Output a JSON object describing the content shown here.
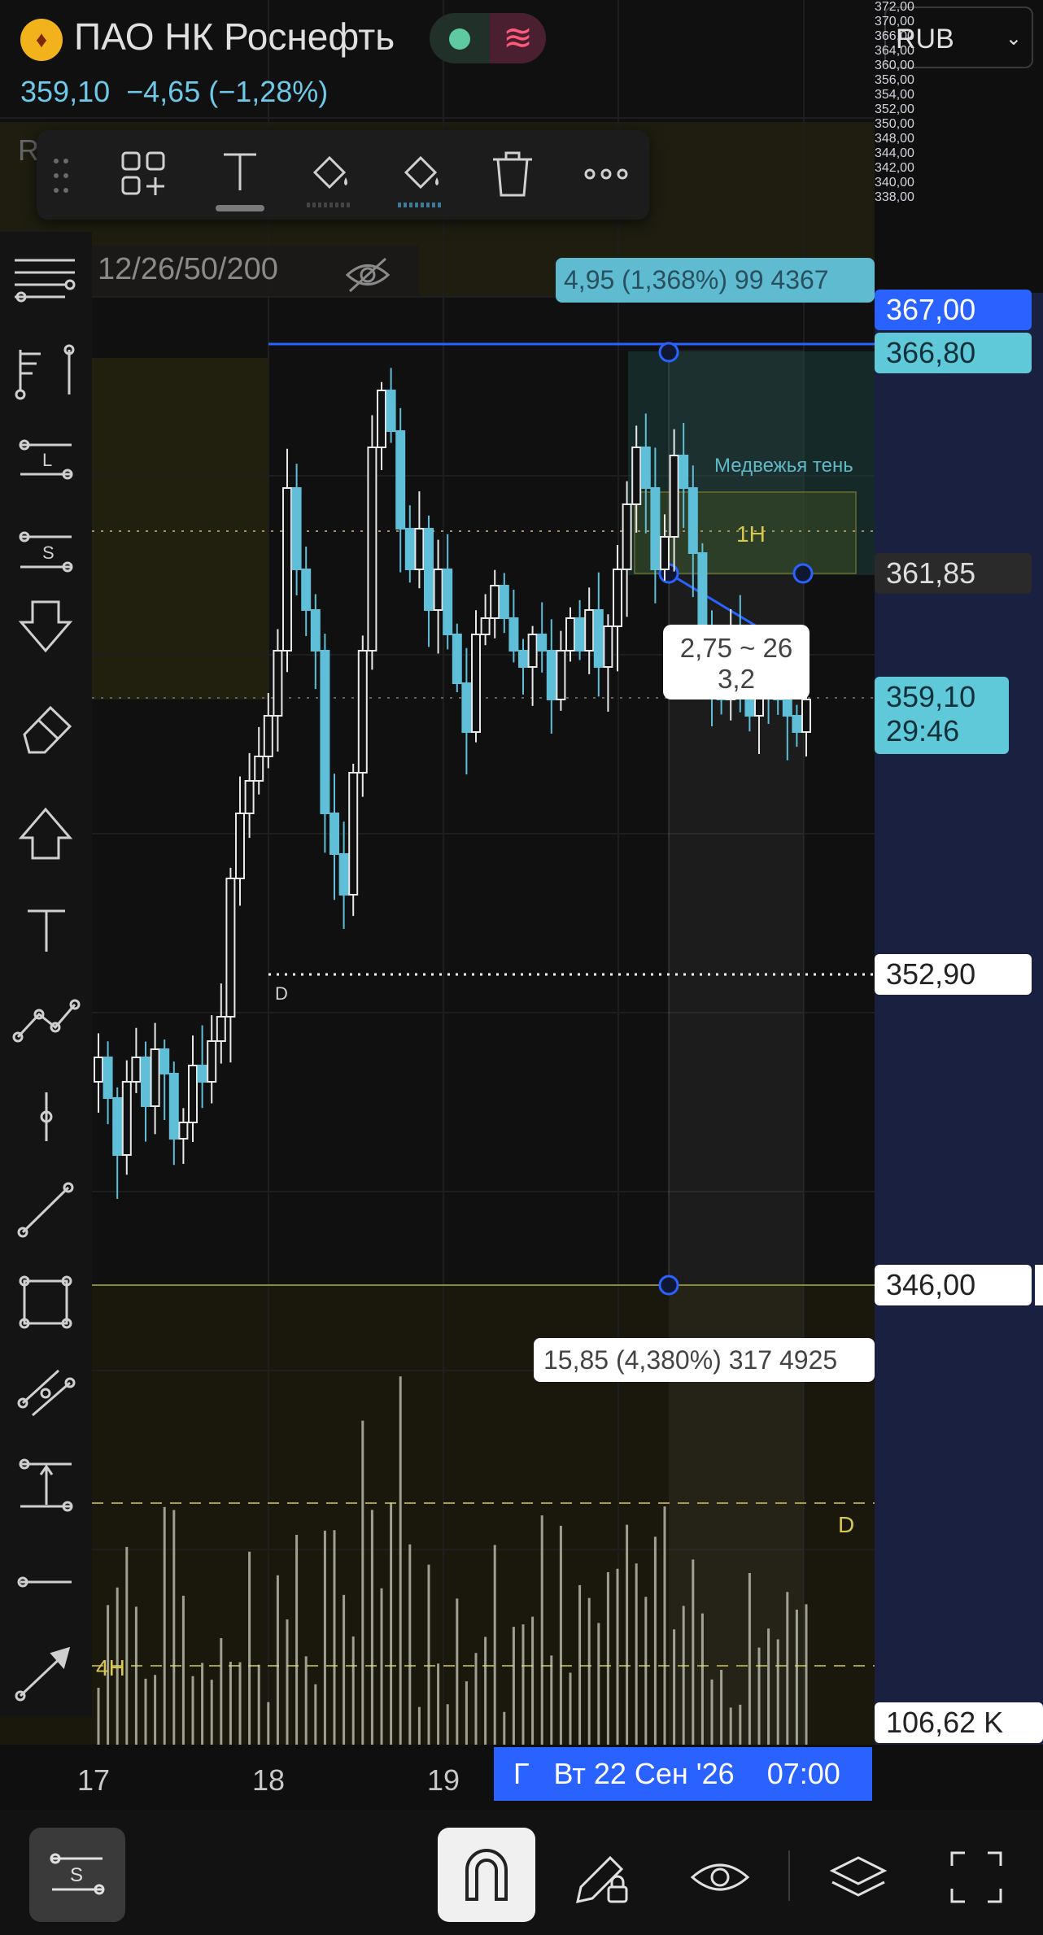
{
  "header": {
    "symbol": "ПАО НК Роснефть",
    "price": "359,10",
    "change": "−4,65 (−1,28%)",
    "currency": "RUB"
  },
  "indicator_label": "12/26/50/200",
  "price_scale": {
    "ticks": [
      "372,00",
      "370,00",
      "366,00",
      "364,00",
      "360,00",
      "356,00",
      "354,00",
      "352,00",
      "350,00",
      "348,00",
      "344,00",
      "342,00",
      "340,00",
      "338,00"
    ],
    "labels": {
      "blue_line": "367,00",
      "cyan_level": "366,80",
      "level_361": "361,85",
      "last_price": "359,10",
      "countdown": "29:46",
      "level_352": "352,90",
      "level_346": "346,00",
      "volume": "106,62 K"
    }
  },
  "annotations": {
    "measure_top": "4,95 (1,368%) 99 4367",
    "measure_bottom": "15,85 (4,380%) 317 4925",
    "bear_shadow": "Медвежья тень",
    "tf_1h": "1H",
    "tf_4h": "4H",
    "marker_d": "D",
    "marker_d2": "D",
    "callout_line1": "2,75 ~ 26",
    "callout_line2": "3,2",
    "faded_label": "R"
  },
  "time_axis": {
    "labels": [
      "17",
      "18",
      "19"
    ],
    "cursor_prefix": "Г",
    "cursor": "Вт 22 Сен '26",
    "cursor_time": "07:00"
  },
  "floating_toolbar": [
    "add-widget-icon",
    "text-icon",
    "fill-icon",
    "line-color-icon",
    "delete-icon",
    "more-icon"
  ],
  "left_toolbar": [
    "lines-menu-icon",
    "ruler-long-short-icon",
    "horizontal-line-L-icon",
    "horizontal-line-S-icon",
    "arrow-down-icon",
    "eraser-icon",
    "arrow-up-icon",
    "text-tool-icon",
    "trend-path-icon",
    "vertical-line-icon",
    "trend-line-icon",
    "rectangle-icon",
    "parallel-channel-icon",
    "measure-icon",
    "horizontal-ray-icon",
    "arrow-tool-icon"
  ],
  "bottom_bar": [
    "indicators-icon",
    "magnet-icon",
    "lock-draw-icon",
    "eye-icon",
    "layers-icon",
    "fullscreen-icon"
  ],
  "colors": {
    "up": "#e8e8e8",
    "down": "#5fbfd8",
    "blue": "#2962ff",
    "accent": "#5fc9d9",
    "yellow": "#c8b43a"
  }
}
